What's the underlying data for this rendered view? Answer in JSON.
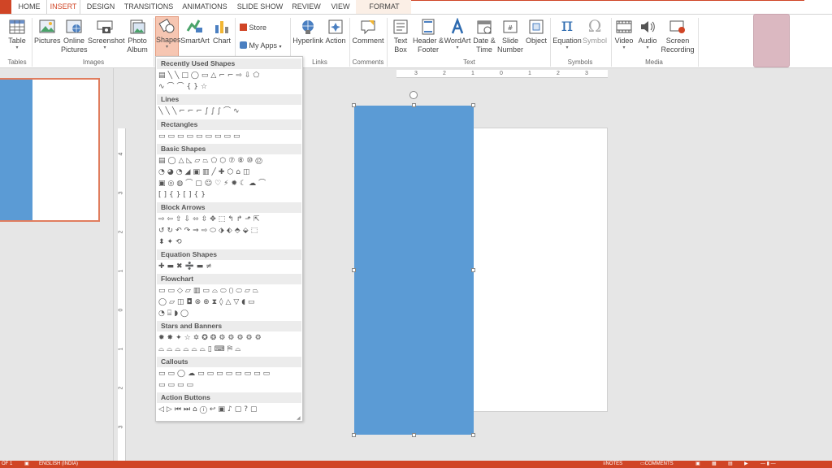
{
  "tabs": [
    {
      "label": "HOME"
    },
    {
      "label": "INSERT"
    },
    {
      "label": "DESIGN"
    },
    {
      "label": "TRANSITIONS"
    },
    {
      "label": "ANIMATIONS"
    },
    {
      "label": "SLIDE SHOW"
    },
    {
      "label": "REVIEW"
    },
    {
      "label": "VIEW"
    },
    {
      "label": "FORMAT"
    }
  ],
  "colors": {
    "accent": "#d04526",
    "shape_fill": "#5b9bd5"
  },
  "ribbon": {
    "table": "Table",
    "pictures": "Pictures",
    "online_pictures": "Online Pictures",
    "screenshot": "Screenshot",
    "photo_album": "Photo Album",
    "shapes": "Shapes",
    "smartart": "SmartArt",
    "chart": "Chart",
    "store": "Store",
    "my_apps": "My Apps",
    "hyperlink": "Hyperlink",
    "action": "Action",
    "comment": "Comment",
    "text_box": "Text Box",
    "header_footer": "Header & Footer",
    "wordart": "WordArt",
    "date_time": "Date & Time",
    "slide_number": "Slide Number",
    "object": "Object",
    "equation": "Equation",
    "symbol": "Symbol",
    "video": "Video",
    "audio": "Audio",
    "screen_recording": "Screen Recording",
    "groups": {
      "tables": "Tables",
      "images": "Images",
      "links": "Links",
      "comments": "Comments",
      "text": "Text",
      "symbols": "Symbols",
      "media": "Media"
    }
  },
  "shapes_menu": {
    "sections": [
      "Recently Used Shapes",
      "Lines",
      "Rectangles",
      "Basic Shapes",
      "Block Arrows",
      "Equation Shapes",
      "Flowchart",
      "Stars and Banners",
      "Callouts",
      "Action Buttons"
    ]
  },
  "ruler": {
    "h_ticks": [
      "3",
      "2",
      "1",
      "0",
      "1",
      "2",
      "3"
    ],
    "v_ticks": [
      "4",
      "3",
      "2",
      "1",
      "0",
      "1",
      "2",
      "3",
      "4"
    ]
  },
  "status": {
    "slide": "OF 1",
    "language": "ENGLISH (INDIA)",
    "notes": "NOTES",
    "comments": "COMMENTS"
  }
}
